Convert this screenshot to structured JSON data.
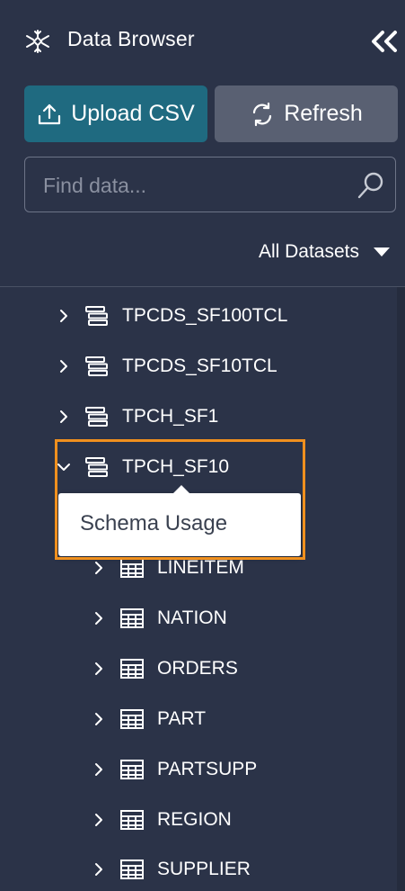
{
  "header": {
    "title": "Data Browser",
    "logo_icon": "snowflake-icon",
    "collapse_icon": "double-chevron-left-icon"
  },
  "toolbar": {
    "upload_label": "Upload CSV",
    "refresh_label": "Refresh"
  },
  "search": {
    "placeholder": "Find data...",
    "value": ""
  },
  "filter": {
    "selected": "All Datasets"
  },
  "tree": {
    "databases": [
      {
        "name": "TPCDS_SF100TCL",
        "expanded": false
      },
      {
        "name": "TPCDS_SF10TCL",
        "expanded": false
      },
      {
        "name": "TPCH_SF1",
        "expanded": false
      },
      {
        "name": "TPCH_SF10",
        "expanded": true
      }
    ],
    "tables": [
      "LINEITEM",
      "NATION",
      "ORDERS",
      "PART",
      "PARTSUPP",
      "REGION",
      "SUPPLIER"
    ]
  },
  "context_menu": {
    "item": "Schema Usage"
  },
  "colors": {
    "background": "#2b3348",
    "upload_button": "#1f6a80",
    "refresh_button": "#596072",
    "highlight": "#f0901e"
  }
}
